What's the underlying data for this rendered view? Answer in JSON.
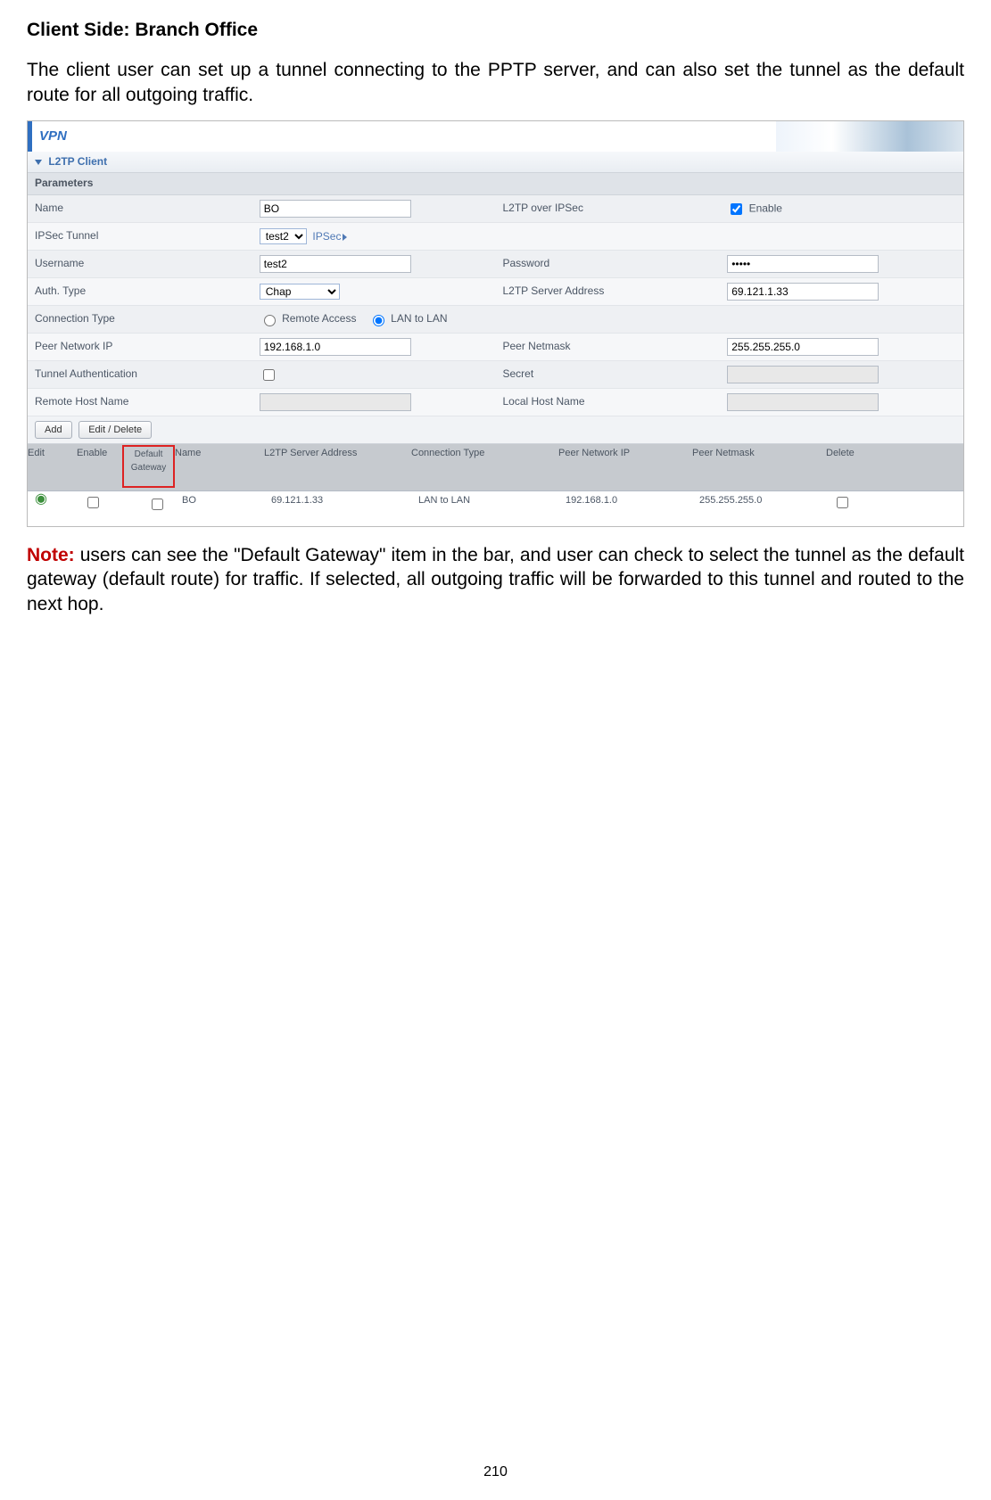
{
  "heading": "Client Side: Branch Office",
  "intro": "The client user can set up a tunnel connecting to the PPTP server, and can also set the tunnel as the default route for all outgoing traffic.",
  "note_label": "Note:",
  "note_text": " users can see the \"Default Gateway\" item in the bar, and user can check to select the tunnel as the default gateway (default route) for traffic. If selected, all outgoing traffic will be forwarded to this tunnel and routed to the next hop.",
  "page_number": "210",
  "panel": {
    "title": "VPN",
    "section": "L2TP Client",
    "params_title": "Parameters",
    "labels": {
      "name": "Name",
      "l2tp_over_ipsec": "L2TP over IPSec",
      "enable": "Enable",
      "ipsec_tunnel": "IPSec Tunnel",
      "ipsec_link": "IPSec",
      "username": "Username",
      "password": "Password",
      "auth_type": "Auth. Type",
      "l2tp_server_addr": "L2TP Server Address",
      "connection_type": "Connection Type",
      "remote_access": "Remote Access",
      "lan_to_lan": "LAN to LAN",
      "peer_network_ip": "Peer Network IP",
      "peer_netmask": "Peer Netmask",
      "tunnel_auth": "Tunnel Authentication",
      "secret": "Secret",
      "remote_host": "Remote Host Name",
      "local_host": "Local Host Name"
    },
    "values": {
      "name": "BO",
      "ipsec_tunnel": "test2",
      "username": "test2",
      "password": "•••••",
      "auth_type": "Chap",
      "l2tp_server_addr": "69.121.1.33",
      "peer_network_ip": "192.168.1.0",
      "peer_netmask": "255.255.255.0"
    },
    "buttons": {
      "add": "Add",
      "edit_delete": "Edit / Delete"
    },
    "list_headers": {
      "edit": "Edit",
      "enable": "Enable",
      "default_gateway": "Default Gateway",
      "name": "Name",
      "l2tp_server_addr": "L2TP Server Address",
      "connection_type": "Connection Type",
      "peer_network_ip": "Peer Network IP",
      "peer_netmask": "Peer Netmask",
      "delete": "Delete"
    },
    "list_row": {
      "name": "BO",
      "l2tp_server_addr": "69.121.1.33",
      "connection_type": "LAN to LAN",
      "peer_network_ip": "192.168.1.0",
      "peer_netmask": "255.255.255.0"
    }
  }
}
